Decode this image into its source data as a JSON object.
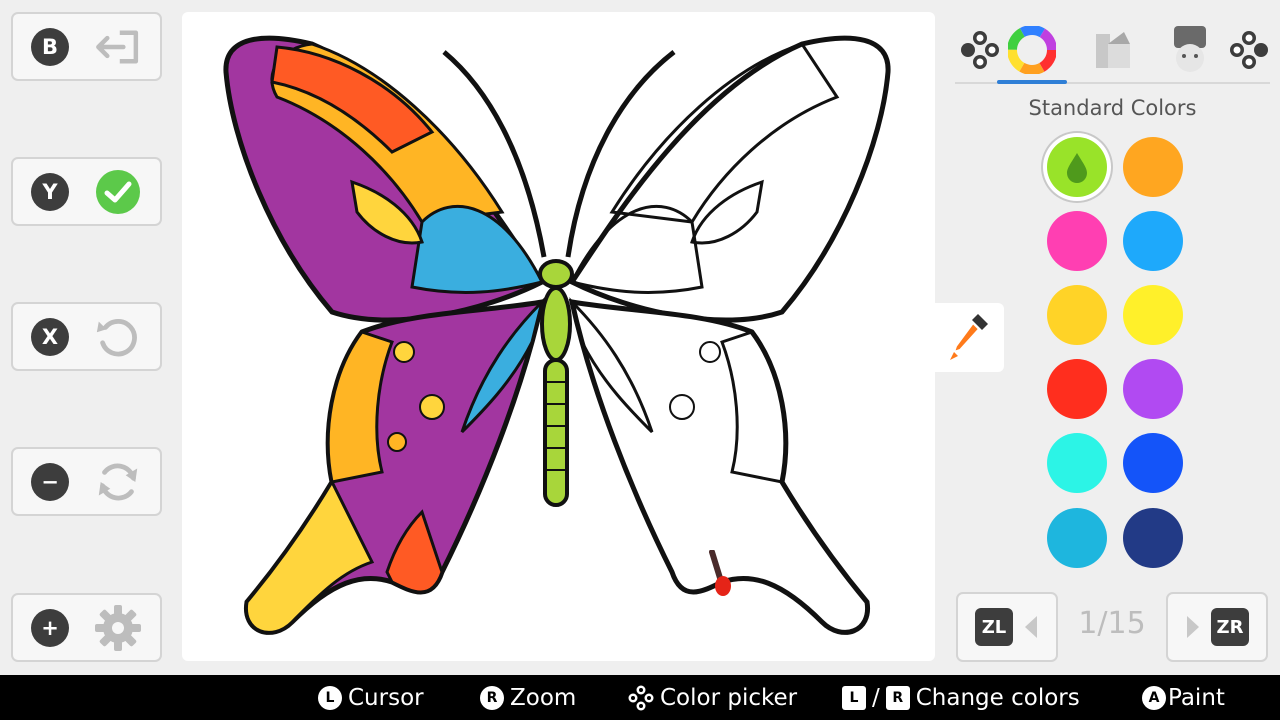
{
  "left_buttons": [
    {
      "key": "B",
      "action": "exit-icon"
    },
    {
      "key": "Y",
      "action": "confirm-icon"
    },
    {
      "key": "X",
      "action": "undo-icon"
    },
    {
      "key": "−",
      "action": "refresh-icon"
    },
    {
      "key": "+",
      "action": "gear-icon"
    }
  ],
  "tabs": [
    {
      "name": "dpad-left-icon"
    },
    {
      "name": "color-wheel-icon",
      "active": true
    },
    {
      "name": "texture-icon"
    },
    {
      "name": "character-icon"
    },
    {
      "name": "dpad-right-icon"
    }
  ],
  "palette": {
    "title": "Standard Colors",
    "colors": [
      "#99e329",
      "#ffa620",
      "#ff3fb2",
      "#1ea9fb",
      "#ffd327",
      "#fff02a",
      "#ff2e1e",
      "#b14af2",
      "#2cf4e6",
      "#1454f9",
      "#1eb6de",
      "#223a86"
    ],
    "selected_index": 0
  },
  "pager": {
    "prev_key": "ZL",
    "next_key": "ZR",
    "count": "1/15"
  },
  "hints": {
    "cursor_key": "L",
    "cursor": "Cursor",
    "zoom_key": "R",
    "zoom": "Zoom",
    "picker": "Color picker",
    "change_l": "L",
    "slash": "/",
    "change_r": "R",
    "change": "Change colors",
    "paint_key": "A",
    "paint": "Paint"
  }
}
